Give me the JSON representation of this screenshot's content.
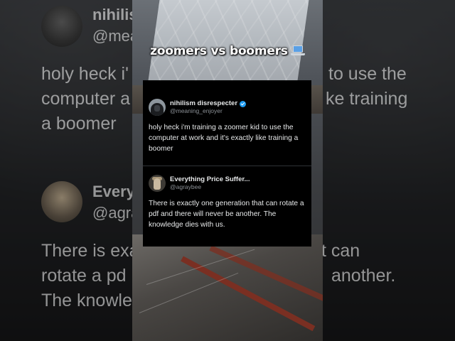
{
  "overlay": {
    "title": "zoomers vs boomers",
    "title_icon": "laptop-icon"
  },
  "tweets": [
    {
      "name": "nihilism disrespecter",
      "handle": "@meaning_enjoyer",
      "verified": true,
      "text": "holy heck i'm training a zoomer kid to use the computer at work and it's exactly like training a boomer"
    },
    {
      "name": "Everything Price Suffer...",
      "handle": "@agraybee",
      "verified": false,
      "text": "There is exactly one generation that can rotate a pdf and there will never be another. The knowledge dies with us."
    }
  ],
  "background_fragments": {
    "name1": "nihilis",
    "handle1": "@mean",
    "line1a": "holy heck i'",
    "line1b": "to use the",
    "line2a": "computer a",
    "line2b": "ke training",
    "line3": "a boomer",
    "name2": "Every",
    "handle2": "@agra",
    "line4a": "There is exa",
    "line4b": "t can",
    "line5a": "rotate a pd",
    "line5b": "another.",
    "line6": "The knowle"
  },
  "colors": {
    "verified_blue": "#1d9bf0",
    "card_bg": "#000000",
    "text_primary": "#e7e9ea",
    "text_secondary": "#8b9096"
  }
}
